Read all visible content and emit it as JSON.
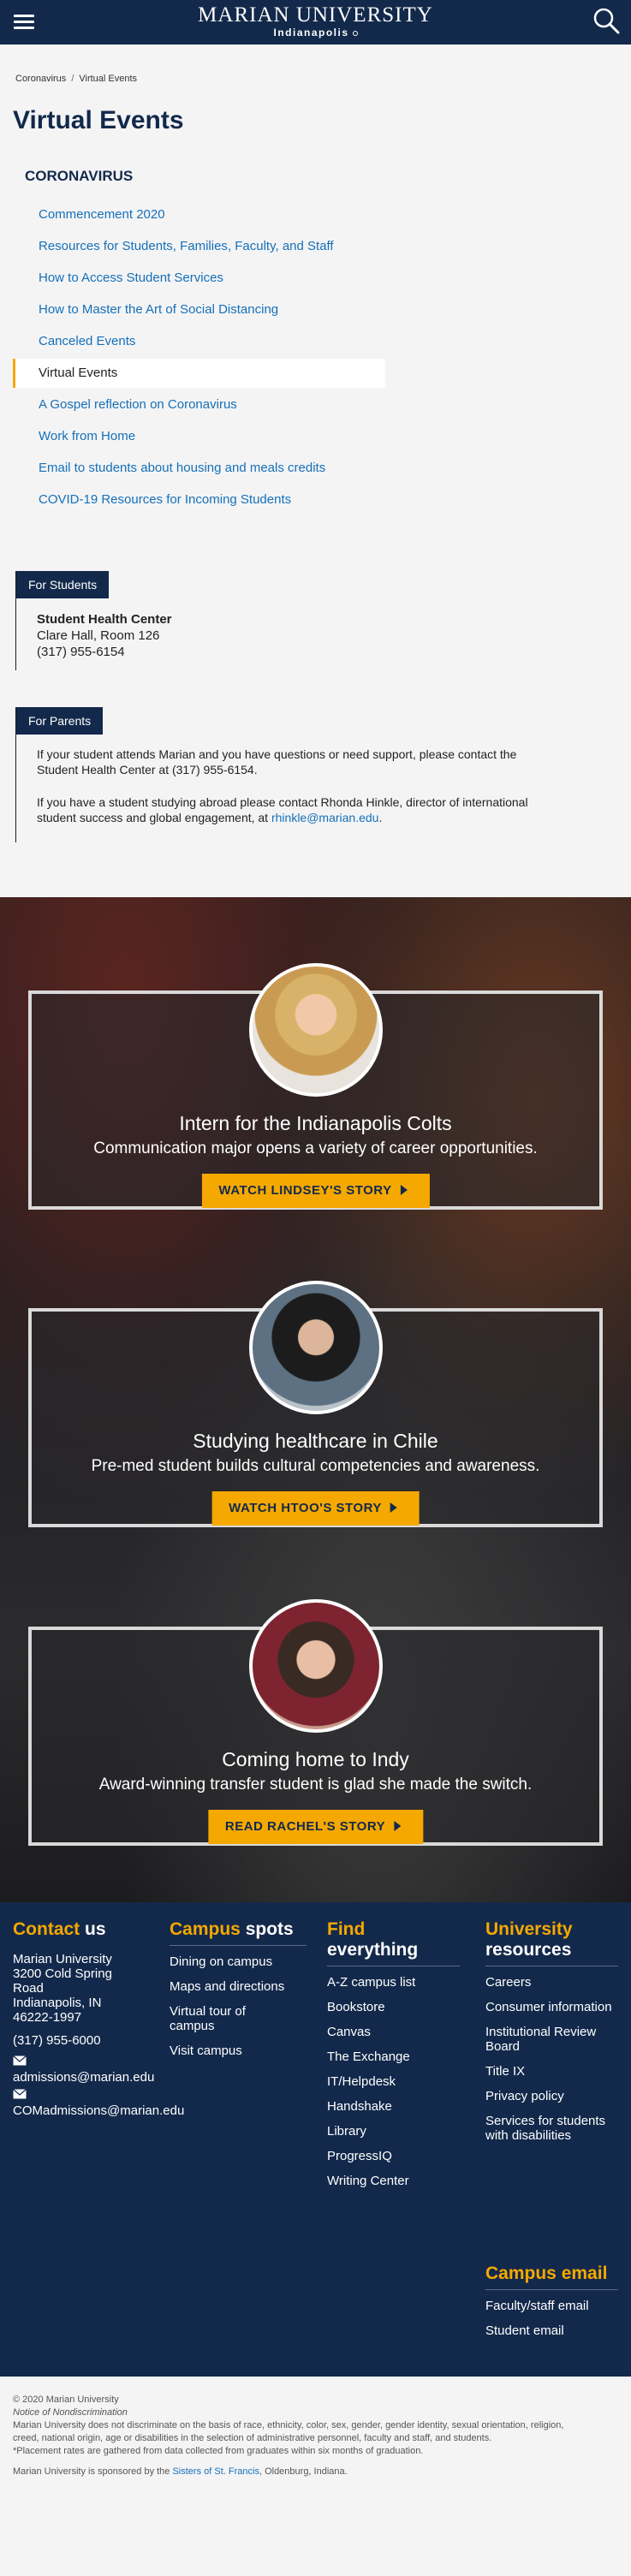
{
  "header": {
    "logo_line1": "MARIAN UNIVERSITY",
    "logo_line2": "Indianapolis",
    "menu_icon": "hamburger-menu-icon",
    "search_icon": "search-icon"
  },
  "breadcrumb": {
    "items": [
      "Coronavirus",
      "Virtual Events"
    ],
    "separator": "/"
  },
  "page_title": "Virtual Events",
  "sidenav": {
    "heading": "CORONAVIRUS",
    "items": [
      "Commencement 2020",
      "Resources for Students, Families, Faculty, and Staff",
      "How to Access Student Services",
      "How to Master the Art of Social Distancing",
      "Canceled Events",
      "Virtual Events",
      "A Gospel reflection on Coronavirus",
      "Work from Home",
      "Email to students about housing and meals credits",
      "COVID-19 Resources for Incoming Students"
    ],
    "active_index": 5
  },
  "for_students": {
    "tag": "For Students",
    "name": "Student Health Center",
    "location": "Clare Hall, Room 126",
    "phone": "(317) 955-6154"
  },
  "for_parents": {
    "tag": "For Parents",
    "p1_line1": "If your student attends Marian and you have questions or need support, please contact the",
    "p1_line2": "Student Health Center at (317) 955-6154.",
    "p2_line1": "If you have a student studying abroad please contact Rhonda Hinkle, director of international",
    "p2_line2_prefix": "student success and global engagement, at ",
    "p2_email": "rhinkle@marian.edu",
    "p2_suffix": "."
  },
  "stories": [
    {
      "title": "Intern for the Indianapolis Colts",
      "subtitle": "Communication major opens a variety of career opportunities.",
      "button": "WATCH LINDSEY'S STORY"
    },
    {
      "title": "Studying healthcare in Chile",
      "subtitle": "Pre-med student builds cultural competencies and awareness.",
      "button": "WATCH HTOO'S STORY"
    },
    {
      "title": "Coming home to Indy",
      "subtitle": "Award-winning transfer student is glad she made the switch.",
      "button": "READ RACHEL'S STORY"
    }
  ],
  "footer": {
    "contact": {
      "heading_a": "Contact",
      "heading_b": "us",
      "address": [
        "Marian University",
        "3200 Cold Spring",
        "Road",
        "Indianapolis, IN",
        "46222-1997"
      ],
      "phone": "(317) 955-6000",
      "email1": "admissions@marian.edu",
      "email2": "COMadmissions@marian.edu"
    },
    "campus_spots": {
      "heading_a": "Campus",
      "heading_b": "spots",
      "items": [
        "Dining on campus",
        "Maps and directions",
        "Virtual tour of campus",
        "Visit campus"
      ]
    },
    "find": {
      "heading_a": "Find",
      "heading_b": "everything",
      "items": [
        "A-Z campus list",
        "Bookstore",
        "Canvas",
        "The Exchange",
        "IT/Helpdesk",
        "Handshake",
        "Library",
        "ProgressIQ",
        "Writing Center"
      ]
    },
    "resources": {
      "heading_a": "University",
      "heading_b": "resources",
      "items": [
        "Careers",
        "Consumer information",
        "Institutional Review Board",
        "Title IX",
        "Privacy policy",
        "Services for students with disabilities"
      ]
    },
    "campus_email": {
      "heading_a": "Campus",
      "heading_b": "email",
      "items": [
        "Faculty/staff email",
        "Student email"
      ]
    }
  },
  "legal": {
    "copyright": "© 2020 Marian University",
    "notice": "Notice of Nondiscrimination",
    "line1": "Marian University does not discriminate on the basis of race, ethnicity, color, sex, gender, gender identity, sexual orientation, religion,",
    "line2": "creed, national origin, age or disabilities in the selection of administrative personnel, faculty and staff, and students.",
    "line3": "*Placement rates are gathered from data collected from graduates within six months of graduation.",
    "sponsor_prefix": "Marian University is sponsored by the ",
    "sponsor_link": "Sisters of St. Francis",
    "sponsor_suffix": ", Oldenburg, Indiana."
  },
  "colors": {
    "navy": "#13294b",
    "gold": "#f5a800",
    "link": "#1570b8"
  }
}
